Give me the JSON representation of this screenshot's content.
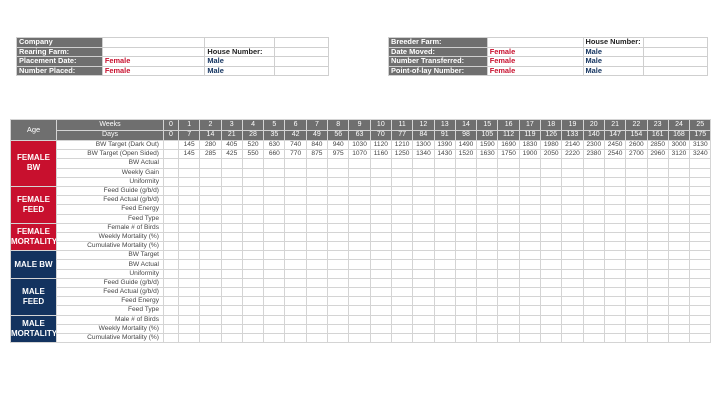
{
  "info_left": [
    {
      "label": "Company",
      "value": "",
      "label2": "",
      "value2": ""
    },
    {
      "label": "Rearing Farm:",
      "value": "",
      "label2": "House Number:",
      "value2": ""
    },
    {
      "label": "Placement Date:",
      "value": "Female",
      "label2": "Male",
      "value2": ""
    },
    {
      "label": "Number Placed:",
      "value": "Female",
      "label2": "Male",
      "value2": ""
    }
  ],
  "info_right": [
    {
      "label": "Breeder Farm:",
      "value": "",
      "label2": "House Number:",
      "value2": ""
    },
    {
      "label": "Date Moved:",
      "value": "Female",
      "label2": "Male",
      "value2": ""
    },
    {
      "label": "Number Transferred:",
      "value": "Female",
      "label2": "Male",
      "value2": ""
    },
    {
      "label": "Point-of-lay Number:",
      "value": "Female",
      "label2": "Male",
      "value2": ""
    }
  ],
  "table": {
    "age_label": "Age",
    "weeks_label": "Weeks",
    "days_label": "Days",
    "weeks": [
      "0",
      "1",
      "2",
      "3",
      "4",
      "5",
      "6",
      "7",
      "8",
      "9",
      "10",
      "11",
      "12",
      "13",
      "14",
      "15",
      "16",
      "17",
      "18",
      "19",
      "20",
      "21",
      "22",
      "23",
      "24",
      "25"
    ],
    "days": [
      "0",
      "7",
      "14",
      "21",
      "28",
      "35",
      "42",
      "49",
      "56",
      "63",
      "70",
      "77",
      "84",
      "91",
      "98",
      "105",
      "112",
      "119",
      "126",
      "133",
      "140",
      "147",
      "154",
      "161",
      "168",
      "175"
    ],
    "groups": [
      {
        "label": "FEMALE BW",
        "color": "f",
        "rows": [
          {
            "label": "BW Target (Dark Out)",
            "values": [
              "",
              "145",
              "280",
              "405",
              "520",
              "630",
              "740",
              "840",
              "940",
              "1030",
              "1120",
              "1210",
              "1300",
              "1390",
              "1490",
              "1590",
              "1690",
              "1830",
              "1980",
              "2140",
              "2300",
              "2450",
              "2600",
              "2850",
              "3000",
              "3130"
            ]
          },
          {
            "label": "BW Target (Open Sided)",
            "values": [
              "",
              "145",
              "285",
              "425",
              "550",
              "660",
              "770",
              "875",
              "975",
              "1070",
              "1160",
              "1250",
              "1340",
              "1430",
              "1520",
              "1630",
              "1750",
              "1900",
              "2050",
              "2220",
              "2380",
              "2540",
              "2700",
              "2960",
              "3120",
              "3240"
            ]
          },
          {
            "label": "BW Actual",
            "values": []
          },
          {
            "label": "Weekly Gain",
            "values": []
          },
          {
            "label": "Uniformity",
            "values": []
          }
        ]
      },
      {
        "label": "FEMALE FEED",
        "color": "f",
        "rows": [
          {
            "label": "Feed Guide (g/b/d)",
            "values": []
          },
          {
            "label": "Feed Actual (g/b/d)",
            "values": []
          },
          {
            "label": "Feed Energy",
            "values": []
          },
          {
            "label": "Feed Type",
            "values": []
          }
        ]
      },
      {
        "label": "FEMALE MORTALITY",
        "color": "f",
        "rows": [
          {
            "label": "Female # of Birds",
            "values": []
          },
          {
            "label": "Weekly Mortality (%)",
            "values": []
          },
          {
            "label": "Cumulative Mortality (%)",
            "values": []
          }
        ]
      },
      {
        "label": "MALE BW",
        "color": "m",
        "rows": [
          {
            "label": "BW Target",
            "values": []
          },
          {
            "label": "BW Actual",
            "values": []
          },
          {
            "label": "Uniformity",
            "values": []
          }
        ]
      },
      {
        "label": "MALE FEED",
        "color": "m",
        "rows": [
          {
            "label": "Feed Guide (g/b/d)",
            "values": []
          },
          {
            "label": "Feed Actual (g/b/d)",
            "values": []
          },
          {
            "label": "Feed Energy",
            "values": []
          },
          {
            "label": "Feed Type",
            "values": []
          }
        ]
      },
      {
        "label": "MALE MORTALITY",
        "color": "m",
        "rows": [
          {
            "label": "Male # of Birds",
            "values": []
          },
          {
            "label": "Weekly Mortality (%)",
            "values": []
          },
          {
            "label": "Cumulative Mortality (%)",
            "values": []
          }
        ]
      }
    ]
  }
}
